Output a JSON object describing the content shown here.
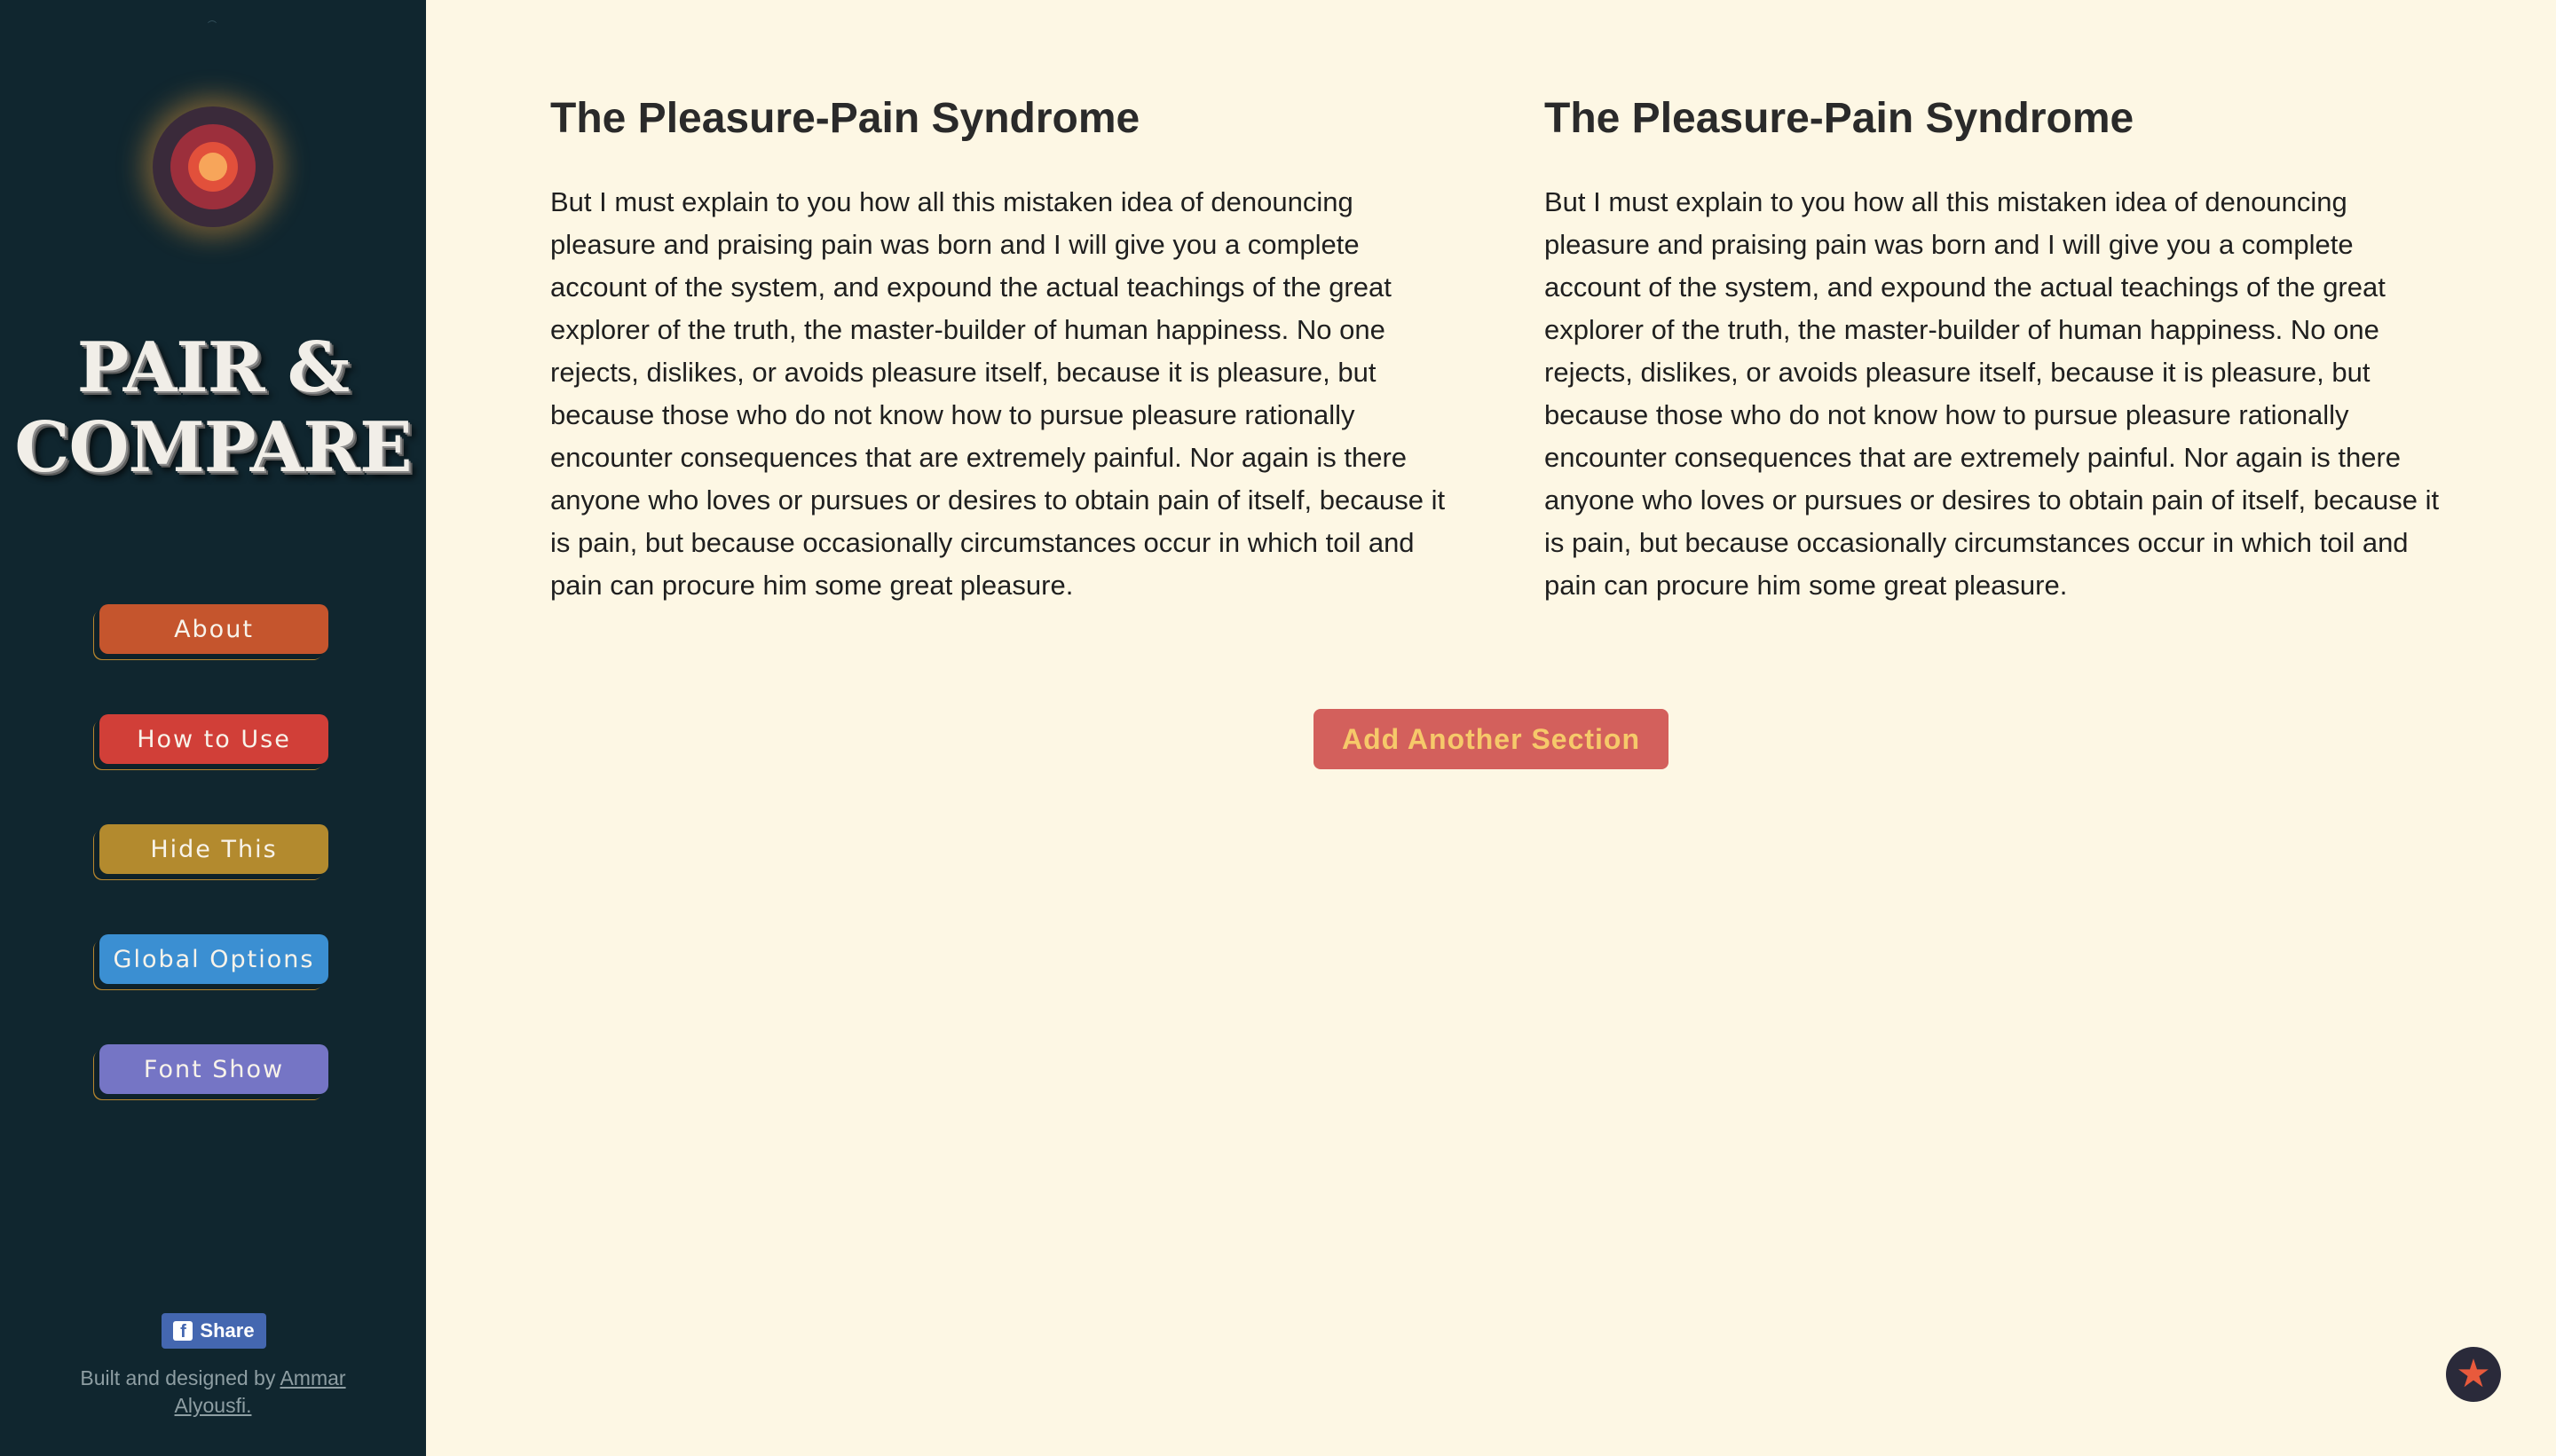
{
  "sidebar": {
    "brand_line1": "PAIR &",
    "brand_line2": "COMPARE",
    "nav": [
      {
        "label": "About",
        "color": "#c5552d"
      },
      {
        "label": "How to Use",
        "color": "#d13f38"
      },
      {
        "label": "Hide This",
        "color": "#b38a2e"
      },
      {
        "label": "Global Options",
        "color": "#3b8fd2"
      },
      {
        "label": "Font Show",
        "color": "#7575c5"
      }
    ],
    "share_label": "Share",
    "credit_prefix": "Built and designed by ",
    "credit_author": "Ammar Alyousfi."
  },
  "sections": [
    {
      "title": "The Pleasure-Pain Syndrome",
      "body": "But I must explain to you how all this mistaken idea of denouncing pleasure and praising pain was born and I will give you a complete account of the system, and expound the actual teachings of the great explorer of the truth, the master-builder of human happiness. No one rejects, dislikes, or avoids pleasure itself, because it is pleasure, but because those who do not know how to pursue pleasure rationally encounter consequences that are extremely painful. Nor again is there anyone who loves or pursues or desires to obtain pain of itself, because it is pain, but because occasionally circumstances occur in which toil and pain can procure him some great pleasure."
    },
    {
      "title": "The Pleasure-Pain Syndrome",
      "body": "But I must explain to you how all this mistaken idea of denouncing pleasure and praising pain was born and I will give you a complete account of the system, and expound the actual teachings of the great explorer of the truth, the master-builder of human happiness. No one rejects, dislikes, or avoids pleasure itself, because it is pleasure, but because those who do not know how to pursue pleasure rationally encounter consequences that are extremely painful. Nor again is there anyone who loves or pursues or desires to obtain pain of itself, because it is pain, but because occasionally circumstances occur in which toil and pain can procure him some great pleasure."
    }
  ],
  "main": {
    "add_section_label": "Add Another Section"
  },
  "icons": {
    "logo": "concentric-circles-logo",
    "share": "facebook-icon",
    "fab": "star-icon"
  }
}
